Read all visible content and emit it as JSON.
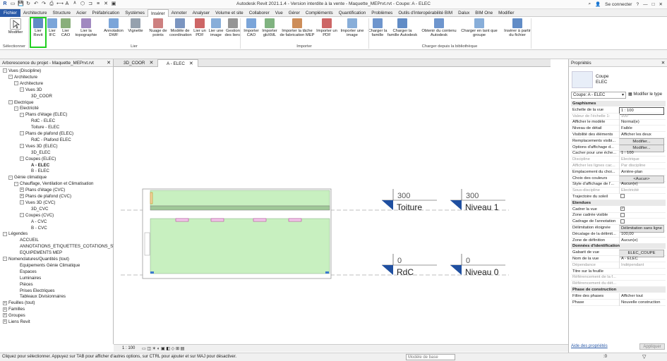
{
  "titlebar": {
    "title": "Autodesk Revit 2021.1.4 - Version interdite à la vente - Maquette_MEPrvt.rvt - Coupe: A - ELEC",
    "user": "Se connecter",
    "qat_icons": [
      "revit-logo-icon",
      "open-icon",
      "save-icon",
      "sync-icon",
      "undo-icon",
      "redo-icon",
      "print-icon",
      "measure-icon",
      "annotation-icon",
      "text-icon",
      "3d-view-icon",
      "section-icon",
      "thin-lines-icon",
      "close-hidden-icon",
      "switch-windows-icon"
    ]
  },
  "tabs": [
    "Fichier",
    "Architecture",
    "Structure",
    "Acier",
    "Préfabrication",
    "Systèmes",
    "Insérer",
    "Annoter",
    "Analyser",
    "Volume et site",
    "Collaborer",
    "Vue",
    "Gérer",
    "Compléments",
    "Quantification",
    "Problèmes",
    "Outils d'interopérabilité BIM",
    "Dalux",
    "BIM One",
    "Modifier"
  ],
  "active_tab": "Insérer",
  "ribbon": {
    "modify": "Modifier",
    "select_panel": "Sélectionner",
    "link_panel": "Lier",
    "import_panel": "Importer",
    "library_panel": "Charger depuis la bibliothèque",
    "buttons": [
      {
        "label": "Lier Revit"
      },
      {
        "label": "Lier IFC"
      },
      {
        "label": "Lier CAO"
      },
      {
        "label": "Lier la topographie"
      },
      {
        "label": "Annotation DWF"
      },
      {
        "label": "Vignette"
      },
      {
        "label": "Nuage de points"
      },
      {
        "label": "Modèle de coordination"
      },
      {
        "label": "Lier un PDF"
      },
      {
        "label": "Lier une image"
      },
      {
        "label": "Gestion des liens"
      },
      {
        "label": "Importer CAO"
      },
      {
        "label": "Importer gbXML"
      },
      {
        "label": "Importer la tâche de fabrication MEP"
      },
      {
        "label": "Importer un PDF"
      },
      {
        "label": "Importer une image"
      },
      {
        "label": "Charger la famille"
      },
      {
        "label": "Charger la famille Autodesk"
      },
      {
        "label": "Obtenir du contenu Autodesk"
      },
      {
        "label": "Charger en tant que groupe"
      },
      {
        "label": "Insérer à partir du fichier"
      }
    ]
  },
  "browser": {
    "title": "Arborescence du projet - Maquette_MEPrvt.rvt",
    "items": [
      {
        "label": "Vues (Discipline)",
        "toggle": "-"
      },
      {
        "label": "Architecture",
        "toggle": "-"
      },
      {
        "label": "Architecture",
        "toggle": "-"
      },
      {
        "label": "Vues 3D",
        "toggle": "-"
      },
      {
        "label": "3D_COOR",
        "toggle": ""
      },
      {
        "label": "Electrique",
        "toggle": "-"
      },
      {
        "label": "Electricité",
        "toggle": "-"
      },
      {
        "label": "Plans d'étage (ELEC)",
        "toggle": "-"
      },
      {
        "label": "RdC - ELEC",
        "toggle": ""
      },
      {
        "label": "Toiture - ELEC",
        "toggle": ""
      },
      {
        "label": "Plans de plafond (ELEC)",
        "toggle": "-"
      },
      {
        "label": "RdC - Plafond ELEC",
        "toggle": ""
      },
      {
        "label": "Vues 3D (ELEC)",
        "toggle": "-"
      },
      {
        "label": "3D_ELEC",
        "toggle": ""
      },
      {
        "label": "Coupes (ELEC)",
        "toggle": "-"
      },
      {
        "label": "A - ELEC",
        "toggle": ""
      },
      {
        "label": "B - ELEC",
        "toggle": ""
      },
      {
        "label": "Génie climatique",
        "toggle": "-"
      },
      {
        "label": "Chauffage, Ventilation et Climatisation",
        "toggle": "-"
      },
      {
        "label": "Plans d'étage (CVC)",
        "toggle": "+"
      },
      {
        "label": "Plans de plafond (CVC)",
        "toggle": "+"
      },
      {
        "label": "Vues 3D (CVC)",
        "toggle": "-"
      },
      {
        "label": "3D_CVC",
        "toggle": ""
      },
      {
        "label": "Coupes (CVC)",
        "toggle": "-"
      },
      {
        "label": "A - CVC",
        "toggle": ""
      },
      {
        "label": "B - CVC",
        "toggle": ""
      },
      {
        "label": "Légendes",
        "toggle": "-"
      },
      {
        "label": "ACCUEIL",
        "toggle": ""
      },
      {
        "label": "ANNOTATIONS_ETIQUETTES_COTATIONS_SYMBOLE",
        "toggle": ""
      },
      {
        "label": "EQUIPEMENTS MEP",
        "toggle": ""
      },
      {
        "label": "Nomenclatures/Quantités (tout)",
        "toggle": "-"
      },
      {
        "label": "Equipements Génie Climatique",
        "toggle": ""
      },
      {
        "label": "Espaces",
        "toggle": ""
      },
      {
        "label": "Luminaires",
        "toggle": ""
      },
      {
        "label": "Pièces",
        "toggle": ""
      },
      {
        "label": "Prises Electriques",
        "toggle": ""
      },
      {
        "label": "Tableaux Divisionnaires",
        "toggle": ""
      },
      {
        "label": "Feuilles (tout)",
        "toggle": "+"
      },
      {
        "label": "Familles",
        "toggle": "+"
      },
      {
        "label": "Groupes",
        "toggle": "+"
      },
      {
        "label": "Liens Revit",
        "toggle": "+"
      }
    ]
  },
  "view_tabs": [
    {
      "label": "3D_COOR",
      "active": false
    },
    {
      "label": "A - ELEC",
      "active": true
    }
  ],
  "canvas": {
    "levels": [
      {
        "value": "300",
        "name": "Toiture"
      },
      {
        "value": "300",
        "name": "Niveau 1"
      },
      {
        "value": "0",
        "name": "RdC"
      },
      {
        "value": "0",
        "name": "Niveau 0"
      }
    ],
    "colors": {
      "room_fill": "#c8f0c0",
      "level_marker": "#1f4fa0",
      "ceiling": "#a0c898"
    }
  },
  "view_controls": {
    "scale": "1 : 100"
  },
  "status": {
    "hint": "Cliquez pour sélectionner. Appuyez sur TAB pour afficher d'autres options, sur CTRL pour ajouter et sur MAJ pour désactiver.",
    "model": "Modèle de base",
    "counter": ":0"
  },
  "properties": {
    "title": "Propriétés",
    "type_name": "Coupe",
    "type_sub": "ELEC",
    "selector": "Coupe: A - ELEC",
    "edit_type": "Modifier le type",
    "help": "Aide des propriétés",
    "apply": "Appliquer",
    "sections": [
      {
        "name": "Graphismes",
        "rows": [
          {
            "k": "Echelle de la vue",
            "v": "1 : 100",
            "box": true
          },
          {
            "k": "Valeur de l'échelle 1:",
            "v": "100",
            "dim": true
          },
          {
            "k": "Afficher le modèle",
            "v": "Normal(e)"
          },
          {
            "k": "Niveau de détail",
            "v": "Faible"
          },
          {
            "k": "Visibilité des éléments",
            "v": "Afficher les deux"
          },
          {
            "k": "Remplacements visibi...",
            "v": "Modifier...",
            "btn": true
          },
          {
            "k": "Options d'affichage d...",
            "v": "Modifier...",
            "btn": true
          },
          {
            "k": "Cacher pour une éche...",
            "v": "1 : 100"
          },
          {
            "k": "Discipline",
            "v": "Electrique",
            "dim": true
          },
          {
            "k": "Afficher les lignes cac...",
            "v": "Par discipline",
            "dim": true
          },
          {
            "k": "Emplacement du choi...",
            "v": "Arrière-plan"
          },
          {
            "k": "Choix des couleurs",
            "v": "<Aucun>",
            "btn": true
          },
          {
            "k": "Style d'affichage de l'...",
            "v": "Aucun(e)"
          },
          {
            "k": "Sous-discipline",
            "v": "Electricité",
            "dim": true
          },
          {
            "k": "Trajectoire du soleil",
            "v": "",
            "check": false
          }
        ]
      },
      {
        "name": "Etendues",
        "rows": [
          {
            "k": "Cadrer la vue",
            "v": "",
            "check": true
          },
          {
            "k": "Zone cadrée visible",
            "v": "",
            "check": false
          },
          {
            "k": "Cadrage de l'annotation",
            "v": "",
            "check": false
          },
          {
            "k": "Délimitation éloignée",
            "v": "Délimitation sans ligne",
            "btn": true
          },
          {
            "k": "Décalage de la délimit...",
            "v": "100,00"
          },
          {
            "k": "Zone de définition",
            "v": "Aucun(e)"
          }
        ]
      },
      {
        "name": "Données d'identification",
        "rows": [
          {
            "k": "Gabarit de vue",
            "v": "ELEC_COUPE",
            "btn": true
          },
          {
            "k": "Nom de la vue",
            "v": "A - ELEC"
          },
          {
            "k": "Dépendance",
            "v": "Indépendant",
            "dim": true
          },
          {
            "k": "Titre sur la feuille",
            "v": ""
          },
          {
            "k": "Référencement de la f...",
            "v": "",
            "dim": true
          },
          {
            "k": "Référencement du dét...",
            "v": "",
            "dim": true
          }
        ]
      },
      {
        "name": "Phase de construction",
        "rows": [
          {
            "k": "Filtre des phases",
            "v": "Afficher tout"
          },
          {
            "k": "Phase",
            "v": "Nouvelle construction"
          }
        ]
      }
    ]
  }
}
